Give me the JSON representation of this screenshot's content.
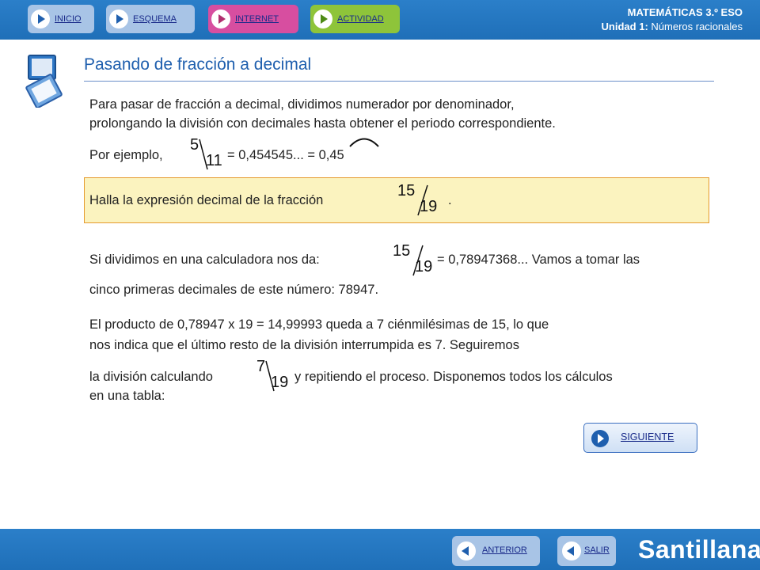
{
  "nav": {
    "inicio": "INICIO",
    "esquema": "ESQUEMA",
    "internet": "INTERNET",
    "actividad": "ACTIVIDAD"
  },
  "header": {
    "subject": "MATEMÁTICAS 3.º ESO",
    "unit_label": "Unidad 1:",
    "unit_name": " Números racionales"
  },
  "page": {
    "title": "Pasando de fracción a decimal",
    "intro_line1": "Para pasar de fracción a decimal, dividimos numerador por denominador,",
    "intro_line2": "prolongando la división con decimales hasta obtener el periodo correspondiente.",
    "example_prefix": "Por ejemplo,",
    "example_frac": {
      "num": "5",
      "den": "11"
    },
    "example_result": "= 0,454545... = 0,45",
    "task_text": "Halla la expresión decimal de la fracción",
    "task_frac": {
      "num": "15",
      "den": "19"
    },
    "task_end": ".",
    "calc_prefix": "Si dividimos en una calculadora nos da:",
    "calc_frac": {
      "num": "15",
      "den": "19"
    },
    "calc_result": "= 0,78947368... Vamos a tomar las",
    "calc_line2": "cinco primeras decimales de este número: 78947.",
    "prod_line1": "El producto de 0,78947 x 19 = 14,99993 queda a 7 ciénmilésimas de 15, lo que",
    "prod_line2": "nos indica que el último resto de la división interrumpida es 7. Seguiremos",
    "cont_prefix": "la división calculando",
    "cont_frac": {
      "num": "7",
      "den": "19"
    },
    "cont_suffix": "y repitiendo el proceso. Disponemos todos los cálculos",
    "cont_line2": "en una tabla:"
  },
  "buttons": {
    "siguiente": "SIGUIENTE",
    "anterior": "ANTERIOR",
    "salir": "SALIR"
  },
  "brand": "Santillana",
  "colors": {
    "header_blue": "#1f6fb8",
    "title_blue": "#1f5fae",
    "task_bg": "#fbf3bf",
    "task_border": "#e59a2e"
  }
}
